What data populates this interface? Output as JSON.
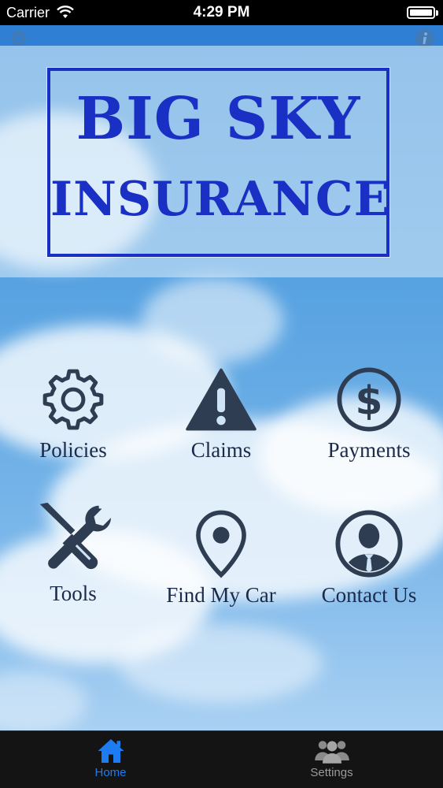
{
  "status_bar": {
    "carrier": "Carrier",
    "time": "4:29 PM"
  },
  "logo": {
    "line1": "BIG SKY",
    "line2": "INSURANCE"
  },
  "top_bar": {
    "left_icon": "gear-icon",
    "right_icon": "info-icon"
  },
  "menu": {
    "items": [
      {
        "label": "Policies",
        "icon": "gear-icon"
      },
      {
        "label": "Claims",
        "icon": "warning-icon"
      },
      {
        "label": "Payments",
        "icon": "dollar-icon"
      },
      {
        "label": "Tools",
        "icon": "tools-icon"
      },
      {
        "label": "Find My Car",
        "icon": "location-pin-icon"
      },
      {
        "label": "Contact Us",
        "icon": "contact-person-icon"
      }
    ]
  },
  "tab_bar": {
    "tabs": [
      {
        "label": "Home",
        "icon": "home-icon",
        "selected": true
      },
      {
        "label": "Settings",
        "icon": "people-icon",
        "selected": false
      }
    ]
  },
  "colors": {
    "logo_blue": "#1a2fc4",
    "icon_dark": "#2f3d52",
    "tab_active": "#1e7cf2",
    "tab_inactive": "#9a9a9a"
  }
}
